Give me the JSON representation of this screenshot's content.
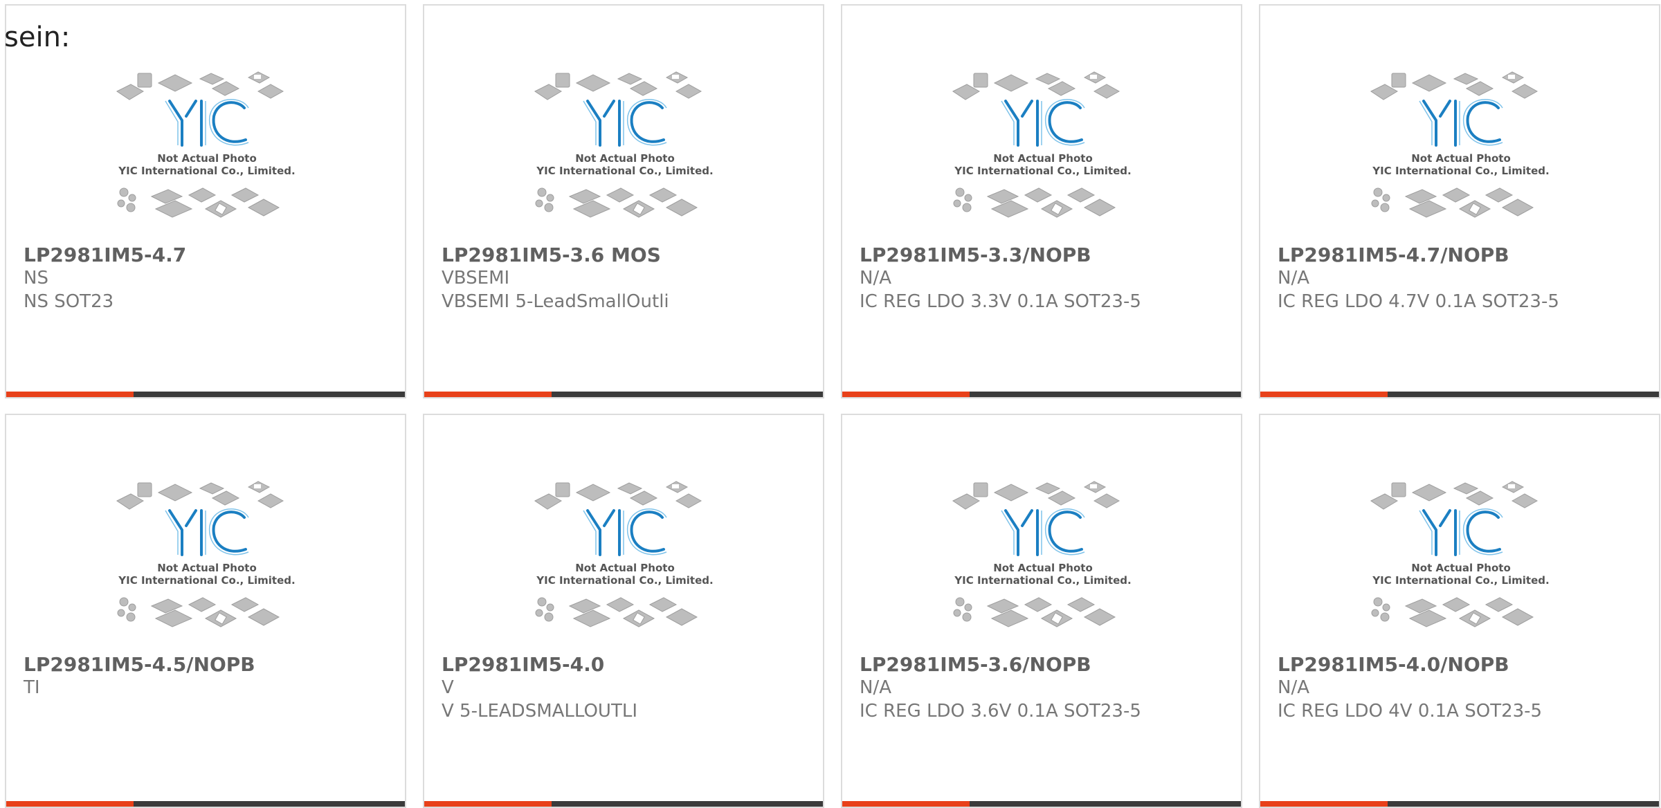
{
  "lead_text": "sein:",
  "placeholder_image": {
    "caption_line1": "Not Actual Photo",
    "caption_line2": "YIC International Co., Limited."
  },
  "colors": {
    "accent": "#e8411a",
    "bar_dark": "#3b3b3b",
    "logo_blue": "#1b7fc2",
    "title_gray": "#606060",
    "text_gray": "#777777",
    "border_gray": "#dcdcdc"
  },
  "accent_bar_fraction": 0.32,
  "products": [
    {
      "part": "LP2981IM5-4.7",
      "maker": "NS",
      "desc": "NS SOT23"
    },
    {
      "part": "LP2981IM5-3.6 MOS",
      "maker": "VBSEMI",
      "desc": "VBSEMI 5-LeadSmallOutli"
    },
    {
      "part": "LP2981IM5-3.3/NOPB",
      "maker": "N/A",
      "desc": "IC REG LDO 3.3V 0.1A SOT23-5"
    },
    {
      "part": "LP2981IM5-4.7/NOPB",
      "maker": "N/A",
      "desc": "IC REG LDO 4.7V 0.1A SOT23-5"
    },
    {
      "part": "LP2981IM5-4.5/NOPB",
      "maker": "TI",
      "desc": ""
    },
    {
      "part": "LP2981IM5-4.0",
      "maker": "V",
      "desc": "V 5-LEADSMALLOUTLI"
    },
    {
      "part": "LP2981IM5-3.6/NOPB",
      "maker": "N/A",
      "desc": "IC REG LDO 3.6V 0.1A SOT23-5"
    },
    {
      "part": "LP2981IM5-4.0/NOPB",
      "maker": "N/A",
      "desc": "IC REG LDO 4V 0.1A SOT23-5"
    }
  ]
}
